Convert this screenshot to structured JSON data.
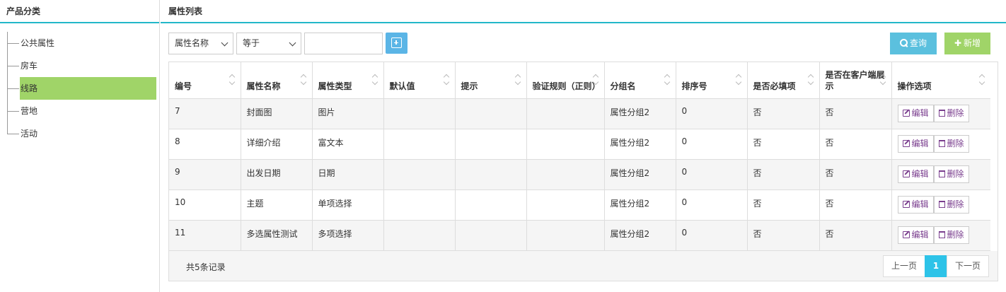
{
  "category_panel": {
    "title": "产品分类",
    "items": [
      {
        "label": "公共属性",
        "active": false
      },
      {
        "label": "房车",
        "active": false
      },
      {
        "label": "线路",
        "active": true
      },
      {
        "label": "营地",
        "active": false
      },
      {
        "label": "活动",
        "active": false
      }
    ]
  },
  "attr_panel": {
    "title": "属性列表",
    "filters": {
      "field_select": "属性名称",
      "operator_select": "等于",
      "value": ""
    },
    "search_label": "查询",
    "new_label": "新增",
    "columns": [
      "编号",
      "属性名称",
      "属性类型",
      "默认值",
      "提示",
      "验证规则（正则）",
      "分组名",
      "排序号",
      "是否必填项",
      "是否在客户端展示",
      "操作选项"
    ],
    "rows": [
      {
        "id": "7",
        "name": "封面图",
        "type": "图片",
        "default": "",
        "hint": "",
        "rule": "",
        "group": "属性分组2",
        "order": "0",
        "required": "否",
        "show_client": "否"
      },
      {
        "id": "8",
        "name": "详细介绍",
        "type": "富文本",
        "default": "",
        "hint": "",
        "rule": "",
        "group": "属性分组2",
        "order": "0",
        "required": "否",
        "show_client": "否"
      },
      {
        "id": "9",
        "name": "出发日期",
        "type": "日期",
        "default": "",
        "hint": "",
        "rule": "",
        "group": "属性分组2",
        "order": "0",
        "required": "否",
        "show_client": "否"
      },
      {
        "id": "10",
        "name": "主题",
        "type": "单项选择",
        "default": "",
        "hint": "",
        "rule": "",
        "group": "属性分组2",
        "order": "0",
        "required": "否",
        "show_client": "否"
      },
      {
        "id": "11",
        "name": "多选属性测试",
        "type": "多项选择",
        "default": "",
        "hint": "",
        "rule": "",
        "group": "属性分组2",
        "order": "0",
        "required": "否",
        "show_client": "否"
      }
    ],
    "edit_label": "编辑",
    "delete_label": "删除",
    "total_text": "共5条记录",
    "pager": {
      "prev": "上一页",
      "current": "1",
      "next": "下一页"
    }
  },
  "colors": {
    "accent_line": "#23b7c9",
    "active_item": "#a0d468",
    "search_btn": "#5bc0de",
    "new_btn": "#a0d468",
    "page_current": "#2dc3e8"
  }
}
